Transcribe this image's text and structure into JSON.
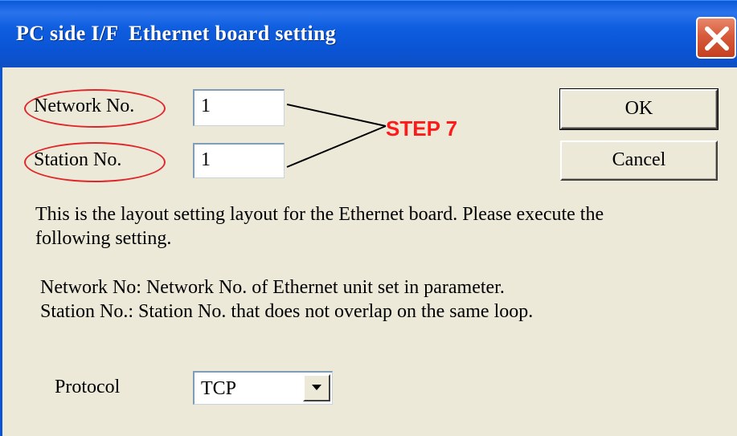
{
  "window": {
    "title": "PC side I/F  Ethernet board setting"
  },
  "fields": {
    "network_no": {
      "label": "Network No.",
      "value": "1"
    },
    "station_no": {
      "label": "Station No.",
      "value": "1"
    }
  },
  "buttons": {
    "ok": "OK",
    "cancel": "Cancel"
  },
  "annotation": {
    "step_label": "STEP 7",
    "color": "#ff1a1a"
  },
  "description": {
    "line1": "This is the layout setting layout for the Ethernet board. Please execute the",
    "line2": "following setting.",
    "detail1": "Network No: Network No. of Ethernet unit set in parameter.",
    "detail2": "Station No.: Station No. that does not overlap on the same loop."
  },
  "protocol": {
    "label": "Protocol",
    "selected": "TCP"
  },
  "icons": {
    "close": "close-icon",
    "dropdown": "chevron-down-icon"
  }
}
